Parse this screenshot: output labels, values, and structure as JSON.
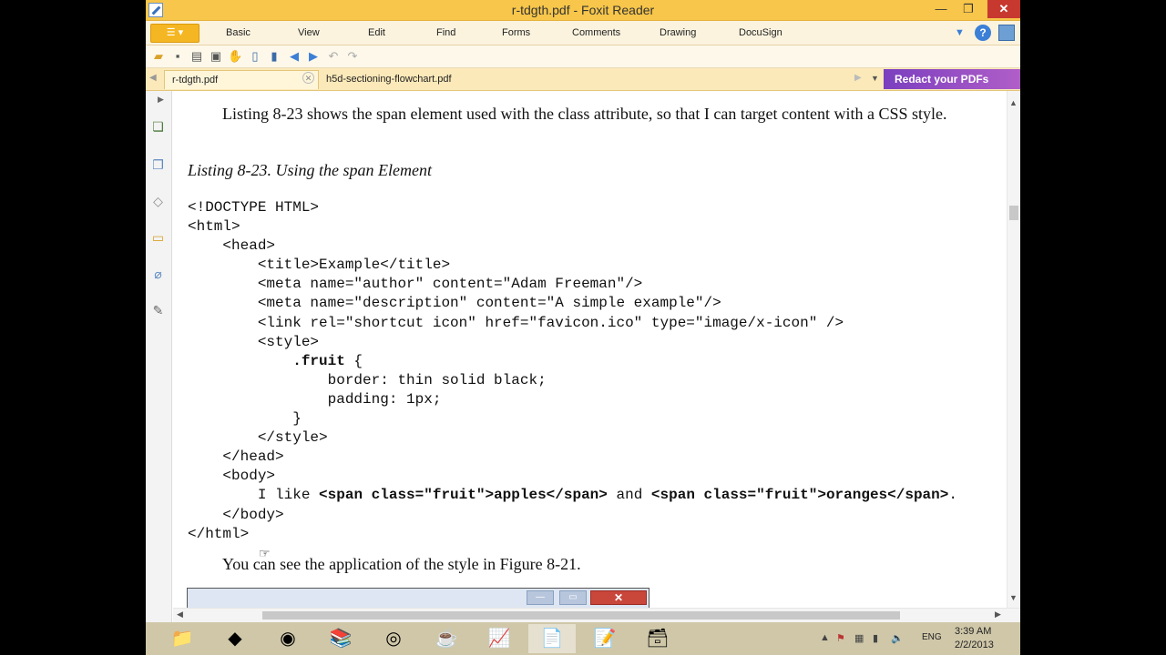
{
  "window": {
    "title": "r-tdgth.pdf - Foxit Reader"
  },
  "ribbon": {
    "tabs": [
      "Basic",
      "View",
      "Edit",
      "Find",
      "Forms",
      "Comments",
      "Drawing",
      "DocuSign"
    ]
  },
  "doc_tabs": [
    {
      "label": "r-tdgth.pdf",
      "active": true
    },
    {
      "label": "h5d-sectioning-flowchart.pdf",
      "active": false
    }
  ],
  "banner": {
    "label": "Redact your PDFs"
  },
  "document": {
    "para1": "Listing 8-23 shows the span element used with the class attribute, so that I can target content with a CSS style.",
    "listing_caption": "Listing 8-23. Using the span Element",
    "code_lines": [
      "<!DOCTYPE HTML>",
      "<html>",
      "    <head>",
      "        <title>Example</title>",
      "        <meta name=\"author\" content=\"Adam Freeman\"/>",
      "        <meta name=\"description\" content=\"A simple example\"/>",
      "        <link rel=\"shortcut icon\" href=\"favicon.ico\" type=\"image/x-icon\" />",
      "        <style>",
      "            .fruit {",
      "                border: thin solid black;",
      "                padding: 1px;",
      "            }",
      "        </style>",
      "    </head>",
      "    <body>",
      "        I like <span class=\"fruit\">apples</span> and <span class=\"fruit\">oranges</span>.",
      "    </body>",
      "</html>"
    ],
    "bold_lines": [
      8,
      15
    ],
    "para2": "You can see the application of the style in Figure 8-21."
  },
  "taskbar": {
    "apps": [
      {
        "name": "file-explorer-icon",
        "glyph": "📁",
        "active": false
      },
      {
        "name": "visual-studio-icon",
        "glyph": "◆",
        "active": false
      },
      {
        "name": "browser-globe-icon",
        "glyph": "◉",
        "active": false
      },
      {
        "name": "books-icon",
        "glyph": "📚",
        "active": false
      },
      {
        "name": "chrome-icon",
        "glyph": "◎",
        "active": false
      },
      {
        "name": "java-icon",
        "glyph": "☕",
        "active": false
      },
      {
        "name": "notepad-chart-icon",
        "glyph": "📈",
        "active": false
      },
      {
        "name": "foxit-reader-icon",
        "glyph": "📄",
        "active": true
      },
      {
        "name": "notepad-green-icon",
        "glyph": "📝",
        "active": false
      },
      {
        "name": "archive-icon",
        "glyph": "🗃",
        "active": false
      }
    ],
    "lang": "ENG",
    "time": "3:39 AM",
    "date": "2/2/2013"
  },
  "colors": {
    "titlebar": "#f7c64a",
    "accent_purple": "#7b3fbf",
    "close_red": "#c7382e",
    "taskbar": "#cfc7a8"
  }
}
